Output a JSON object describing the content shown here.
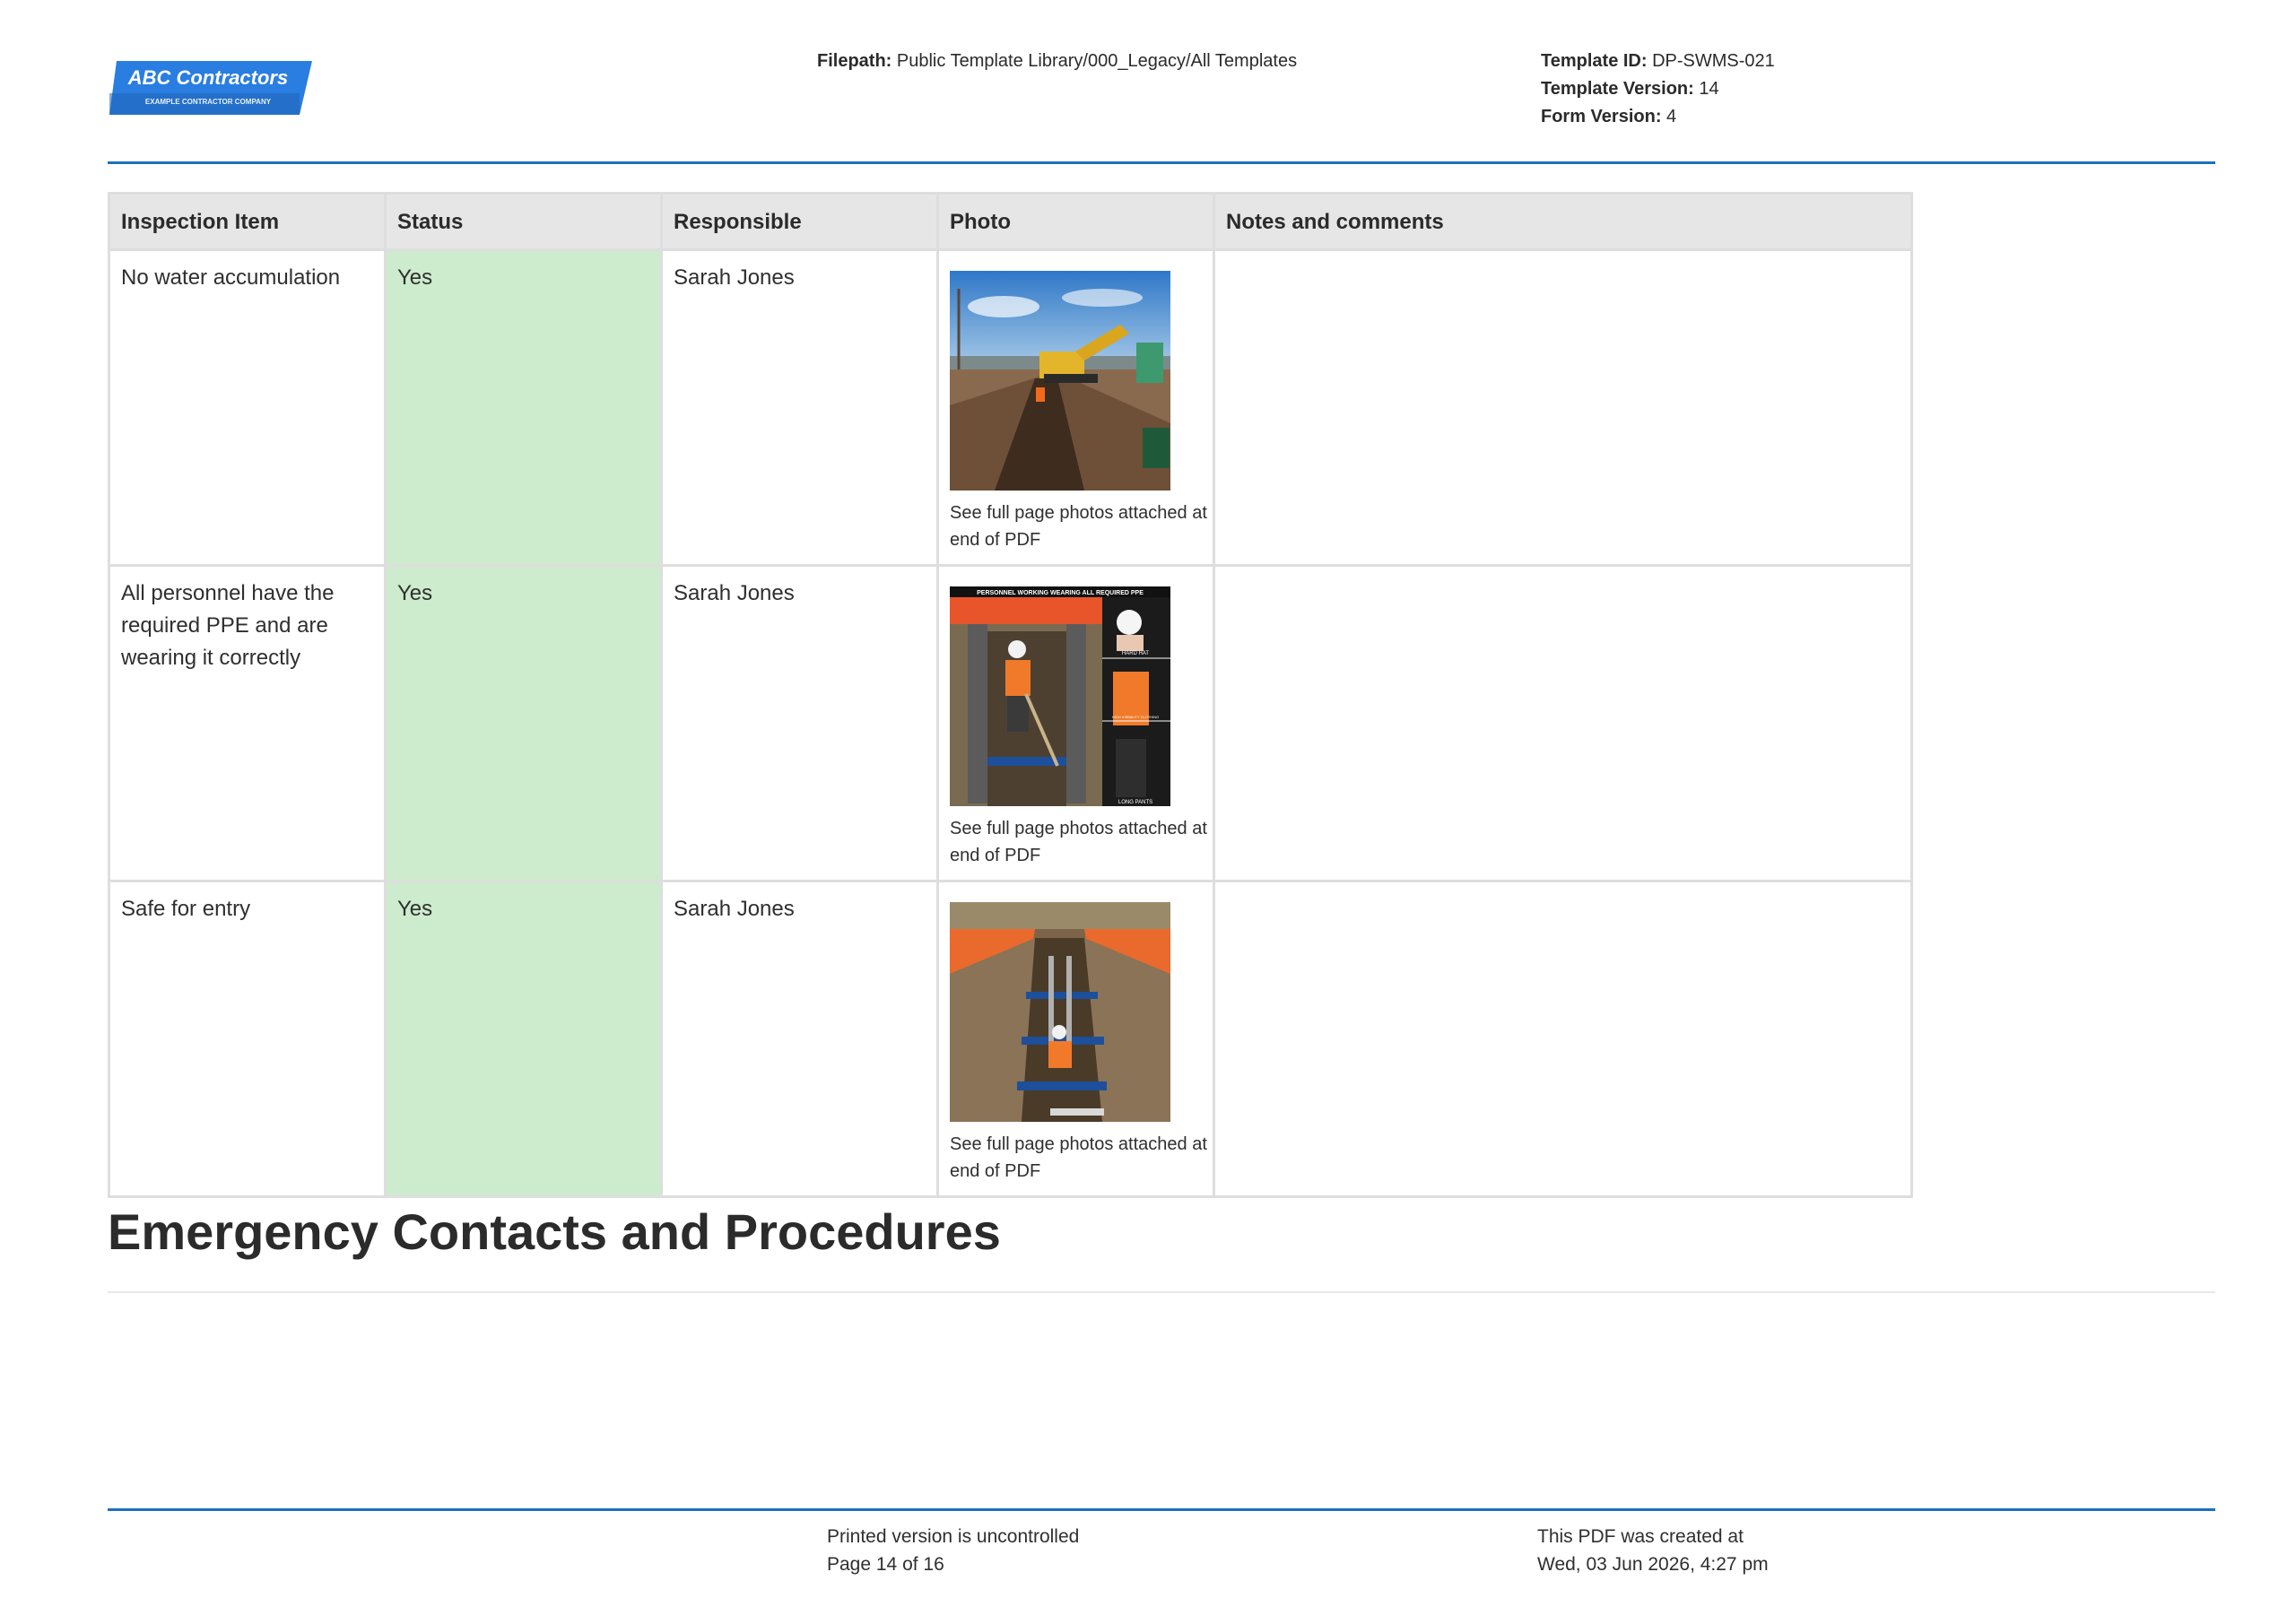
{
  "header": {
    "logo": {
      "name": "ABC Contractors",
      "tagline": "EXAMPLE CONTRACTOR COMPANY",
      "color": "#2a7de1"
    },
    "filepath_label": "Filepath:",
    "filepath_value": "Public Template Library/000_Legacy/All Templates",
    "template_id_label": "Template ID:",
    "template_id_value": "DP-SWMS-021",
    "template_version_label": "Template Version:",
    "template_version_value": "14",
    "form_version_label": "Form Version:",
    "form_version_value": "4"
  },
  "table": {
    "columns": [
      "Inspection Item",
      "Status",
      "Responsible",
      "Photo",
      "Notes and comments"
    ],
    "rows": [
      {
        "item": "No water accumulation",
        "status": "Yes",
        "responsible": "Sarah Jones",
        "photo_caption": "See full page photos attached at end of PDF",
        "notes": ""
      },
      {
        "item": "All personnel have the required PPE and are wearing it correctly",
        "status": "Yes",
        "responsible": "Sarah Jones",
        "photo_caption": "See full page photos attached at end of PDF",
        "photo_overlay": "PERSONNEL WORKING WEARING ALL REQUIRED PPE",
        "photo_labels": [
          "HARD HAT",
          "HIGH VISIBILITY CLOTHING",
          "LONG PANTS"
        ],
        "notes": ""
      },
      {
        "item": "Safe for entry",
        "status": "Yes",
        "responsible": "Sarah Jones",
        "photo_caption": "See full page photos attached at end of PDF",
        "notes": ""
      }
    ],
    "status_color": "#cdebcd"
  },
  "section": {
    "title": "Emergency Contacts and Procedures"
  },
  "footer": {
    "uncontrolled": "Printed version is uncontrolled",
    "page": "Page 14 of 16",
    "created_label": "This PDF was created at",
    "created_value": "Wed, 03 Jun 2026, 4:27 pm"
  },
  "colors": {
    "accent_rule": "#1f6fc0",
    "header_cell": "#e6e6e6",
    "text": "#2b2b2b"
  }
}
